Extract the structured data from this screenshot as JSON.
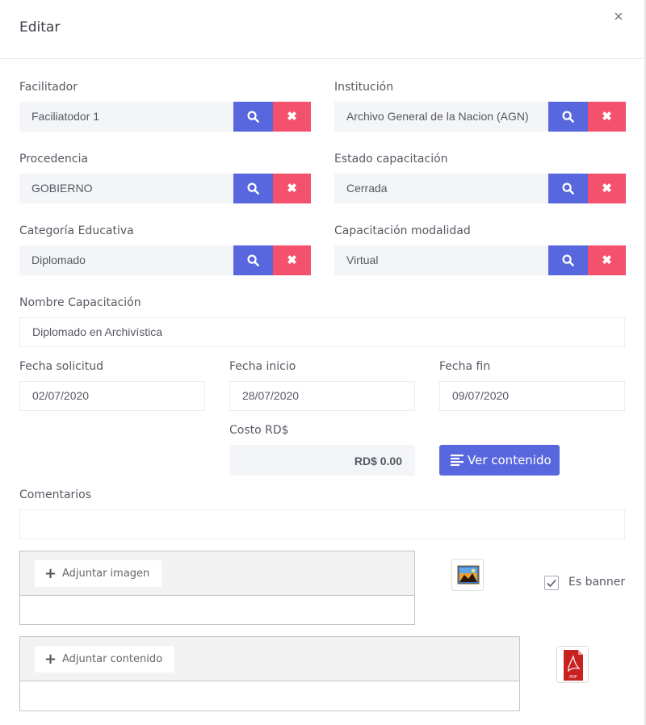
{
  "modal": {
    "title": "Editar",
    "close_glyph": "×"
  },
  "fields": {
    "facilitador": {
      "label": "Facilitador",
      "value": "Faciliatodor 1"
    },
    "institucion": {
      "label": "Institución",
      "value": "Archivo General de la Nacion (AGN)"
    },
    "procedencia": {
      "label": "Procedencia",
      "value": "GOBIERNO"
    },
    "estado": {
      "label": "Estado capacitación",
      "value": "Cerrada"
    },
    "categoria": {
      "label": "Categoría Educativa",
      "value": "Diplomado"
    },
    "modalidad": {
      "label": "Capacitación modalidad",
      "value": "Virtual"
    },
    "nombre": {
      "label": "Nombre Capacitación",
      "value": "Diplomado en Archivística"
    },
    "fecha_solicitud": {
      "label": "Fecha solicitud",
      "value": "02/07/2020"
    },
    "fecha_inicio": {
      "label": "Fecha inicio",
      "value": "28/07/2020"
    },
    "fecha_fin": {
      "label": "Fecha fin",
      "value": "09/07/2020"
    },
    "costo": {
      "label": "Costo RD$",
      "value": "RD$ 0.00"
    },
    "comentarios": {
      "label": "Comentarios",
      "value": ""
    }
  },
  "buttons": {
    "ver_contenido": "Ver contenido",
    "clear_glyph": "✖"
  },
  "uploads": {
    "imagen": {
      "label": "Adjuntar imagen",
      "icon": "image-file-icon"
    },
    "contenido": {
      "label": "Adjuntar contenido",
      "icon": "pdf-file-icon"
    },
    "plus_glyph": "+",
    "pdf_text": "PDF"
  },
  "banner": {
    "label": "Es banner",
    "checked": true
  },
  "colors": {
    "primary": "#5867dd",
    "danger": "#f4516c",
    "input_bg": "#f4f5f8"
  }
}
